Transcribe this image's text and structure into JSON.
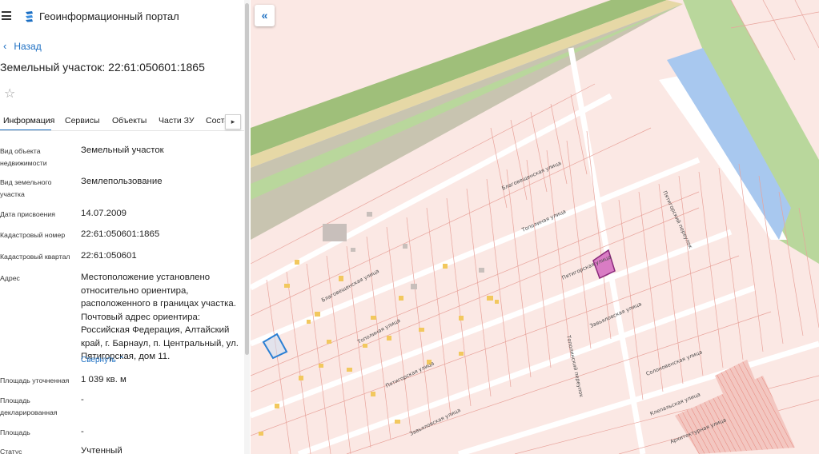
{
  "app": {
    "title": "Геоинформационный портал"
  },
  "nav": {
    "back_label": "Назад"
  },
  "object": {
    "title": "Земельный участок: 22:61:050601:1865"
  },
  "tabs": [
    {
      "label": "Информация",
      "active": true
    },
    {
      "label": "Сервисы"
    },
    {
      "label": "Объекты"
    },
    {
      "label": "Части ЗУ"
    },
    {
      "label": "Соста"
    }
  ],
  "properties": [
    {
      "label": "Вид объекта недвижимости",
      "value": "Земельный участок"
    },
    {
      "label": "Вид земельного участка",
      "value": "Землепользование"
    },
    {
      "label": "Дата присвоения",
      "value": "14.07.2009"
    },
    {
      "label": "Кадастровый номер",
      "value": "22:61:050601:1865"
    },
    {
      "label": "Кадастровый квартал",
      "value": "22:61:050601"
    },
    {
      "label": "Адрес",
      "value": "Местоположение установлено относительно ориентира, расположенного в границах участка. Почтовый адрес ориентира: Российская Федерация, Алтайский край, г. Барнаул, п. Центральный, ул. Пятигорская, дом 11."
    },
    {
      "label": "Площадь уточненная",
      "value": "1 039 кв. м"
    },
    {
      "label": "Площадь декларированная",
      "value": "-"
    },
    {
      "label": "Площадь",
      "value": "-"
    },
    {
      "label": "Статус",
      "value": "Учтенный"
    }
  ],
  "address_collapse_label": "Свернуть",
  "map": {
    "streets": {
      "blagoveshchenskaya": "Благовещенская улица",
      "topolinaya": "Тополиная улица",
      "pyatigorskaya": "Пятигорская улица",
      "zavyalovskaya": "Завьяловская улица",
      "solonovenskaya": "Солоновенская улица",
      "klepalskaya": "Клепальская улица",
      "arkhitekturnaya": "Архитектурная улица",
      "pereulok1": "Тополинский переулок",
      "pereulok2": "Пятигорский переулок"
    },
    "colors": {
      "parcel_fill": "#fbe8e4",
      "parcel_stroke": "#e8a39b",
      "green": "#9fbf7a",
      "green_light": "#c8e2b0",
      "water": "#a8c8ef",
      "selected": "#d97cc4",
      "highlight": "#2a7fd4"
    }
  }
}
